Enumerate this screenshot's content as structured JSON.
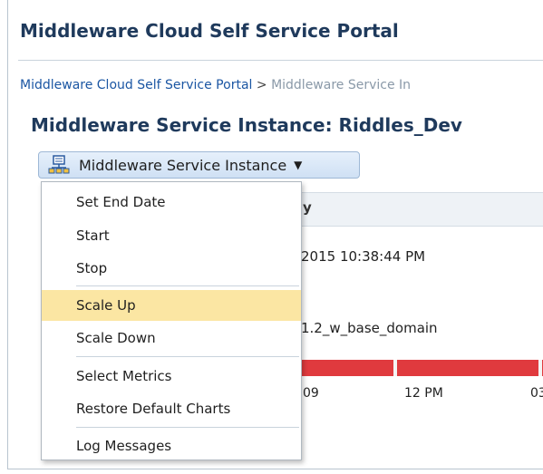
{
  "app": {
    "title": "Middleware Cloud Self Service Portal"
  },
  "breadcrumb": {
    "link": "Middleware Cloud Self Service Portal",
    "separator": ">",
    "current": "Middleware Service In"
  },
  "page": {
    "title": "Middleware Service Instance: Riddles_Dev"
  },
  "menu_button": {
    "label": "Middleware Service Instance",
    "icon": "service-instance-icon",
    "caret": "▼"
  },
  "menu": {
    "items": [
      {
        "label": "Set End Date",
        "highlighted": false
      },
      {
        "label": "Start",
        "highlighted": false
      },
      {
        "label": "Stop",
        "highlighted": false
      },
      {
        "label": "Scale Up",
        "highlighted": true
      },
      {
        "label": "Scale Down",
        "highlighted": false
      },
      {
        "label": "Select Metrics",
        "highlighted": false
      },
      {
        "label": "Restore Default Charts",
        "highlighted": false
      },
      {
        "label": "Log Messages",
        "highlighted": false
      }
    ]
  },
  "background": {
    "column_fragment": "y",
    "date_fragment": "2015 10:38:44 PM",
    "domain_fragment": "1.2_w_base_domain",
    "chart_ticks": [
      "09",
      "12 PM",
      "03"
    ]
  },
  "colors": {
    "title": "#1f3a5c",
    "link": "#1b56a3",
    "highlight": "#fbe6a3",
    "chart_bar": "#e03a3e"
  }
}
